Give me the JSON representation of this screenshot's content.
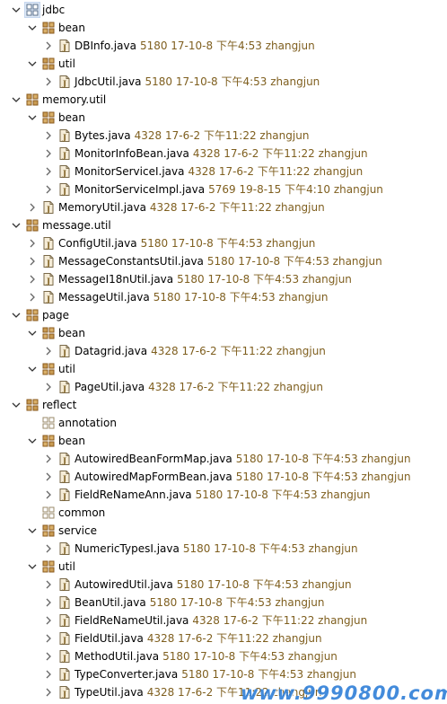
{
  "tree": [
    {
      "kind": "package",
      "expand": "down",
      "name": "jdbc",
      "selected": true
    },
    {
      "kind": "package",
      "expand": "down",
      "name": "bean"
    },
    {
      "kind": "file",
      "expand": "right",
      "name": "DBInfo.java",
      "meta": "5180  17-10-8 下午4:53  zhangjun"
    },
    {
      "kind": "package",
      "expand": "down",
      "name": "util"
    },
    {
      "kind": "file",
      "expand": "right",
      "name": "JdbcUtil.java",
      "meta": "5180  17-10-8 下午4:53  zhangjun"
    },
    {
      "kind": "package",
      "expand": "down",
      "name": "memory.util"
    },
    {
      "kind": "package",
      "expand": "down",
      "name": "bean"
    },
    {
      "kind": "file",
      "expand": "right",
      "name": "Bytes.java",
      "meta": "4328  17-6-2 下午11:22  zhangjun"
    },
    {
      "kind": "file",
      "expand": "right",
      "name": "MonitorInfoBean.java",
      "meta": "4328  17-6-2 下午11:22  zhangjun"
    },
    {
      "kind": "file",
      "expand": "right",
      "name": "MonitorServiceI.java",
      "meta": "4328  17-6-2 下午11:22  zhangjun"
    },
    {
      "kind": "file",
      "expand": "right",
      "name": "MonitorServiceImpl.java",
      "meta": "5769  19-8-15 下午4:10  zhangjun"
    },
    {
      "kind": "file",
      "expand": "right",
      "name": "MemoryUtil.java",
      "meta": "4328  17-6-2 下午11:22  zhangjun"
    },
    {
      "kind": "package",
      "expand": "down",
      "name": "message.util"
    },
    {
      "kind": "file",
      "expand": "right",
      "name": "ConfigUtil.java",
      "meta": "5180  17-10-8 下午4:53  zhangjun"
    },
    {
      "kind": "file",
      "expand": "right",
      "name": "MessageConstantsUtil.java",
      "meta": "5180  17-10-8 下午4:53  zhangjun"
    },
    {
      "kind": "file",
      "expand": "right",
      "name": "MessageI18nUtil.java",
      "meta": "5180  17-10-8 下午4:53  zhangjun"
    },
    {
      "kind": "file",
      "expand": "right",
      "name": "MessageUtil.java",
      "meta": "5180  17-10-8 下午4:53  zhangjun"
    },
    {
      "kind": "package",
      "expand": "down",
      "name": "page"
    },
    {
      "kind": "package",
      "expand": "down",
      "name": "bean"
    },
    {
      "kind": "file",
      "expand": "right",
      "name": "Datagrid.java",
      "meta": "4328  17-6-2 下午11:22  zhangjun"
    },
    {
      "kind": "package",
      "expand": "down",
      "name": "util"
    },
    {
      "kind": "file",
      "expand": "right",
      "name": "PageUtil.java",
      "meta": "4328  17-6-2 下午11:22  zhangjun"
    },
    {
      "kind": "package",
      "expand": "down",
      "name": "reflect"
    },
    {
      "kind": "package-empty",
      "expand": "none",
      "name": "annotation"
    },
    {
      "kind": "package",
      "expand": "down",
      "name": "bean"
    },
    {
      "kind": "file",
      "expand": "right",
      "name": "AutowiredBeanFormMap.java",
      "meta": "5180  17-10-8 下午4:53  zhangjun"
    },
    {
      "kind": "file",
      "expand": "right",
      "name": "AutowiredMapFormBean.java",
      "meta": "5180  17-10-8 下午4:53  zhangjun"
    },
    {
      "kind": "file",
      "expand": "right",
      "name": "FieldReNameAnn.java",
      "meta": "5180  17-10-8 下午4:53  zhangjun"
    },
    {
      "kind": "package-empty",
      "expand": "none",
      "name": "common"
    },
    {
      "kind": "package",
      "expand": "down",
      "name": "service"
    },
    {
      "kind": "file",
      "expand": "right",
      "name": "NumericTypesI.java",
      "meta": "5180  17-10-8 下午4:53  zhangjun"
    },
    {
      "kind": "package",
      "expand": "down",
      "name": "util"
    },
    {
      "kind": "file",
      "expand": "right",
      "name": "AutowiredUtil.java",
      "meta": "5180  17-10-8 下午4:53  zhangjun"
    },
    {
      "kind": "file",
      "expand": "right",
      "name": "BeanUtil.java",
      "meta": "5180  17-10-8 下午4:53  zhangjun"
    },
    {
      "kind": "file",
      "expand": "right",
      "name": "FieldReNameUtil.java",
      "meta": "4328  17-6-2 下午11:22  zhangjun"
    },
    {
      "kind": "file",
      "expand": "right",
      "name": "FieldUtil.java",
      "meta": "4328  17-6-2 下午11:22  zhangjun"
    },
    {
      "kind": "file",
      "expand": "right",
      "name": "MethodUtil.java",
      "meta": "5180  17-10-8 下午4:53  zhangjun"
    },
    {
      "kind": "file",
      "expand": "right",
      "name": "TypeConverter.java",
      "meta": "5180  17-10-8 下午4:53  zhangjun"
    },
    {
      "kind": "file",
      "expand": "right",
      "name": "TypeUtil.java",
      "meta": "4328  17-6-2 下午11:22  zhangjun"
    }
  ],
  "watermark": "www.9990800.com",
  "colors": {
    "meta": "#7f5f1f",
    "selection": "#dde8f6",
    "package_fill": "#c89b52",
    "file_fill": "#f5ecd7"
  }
}
